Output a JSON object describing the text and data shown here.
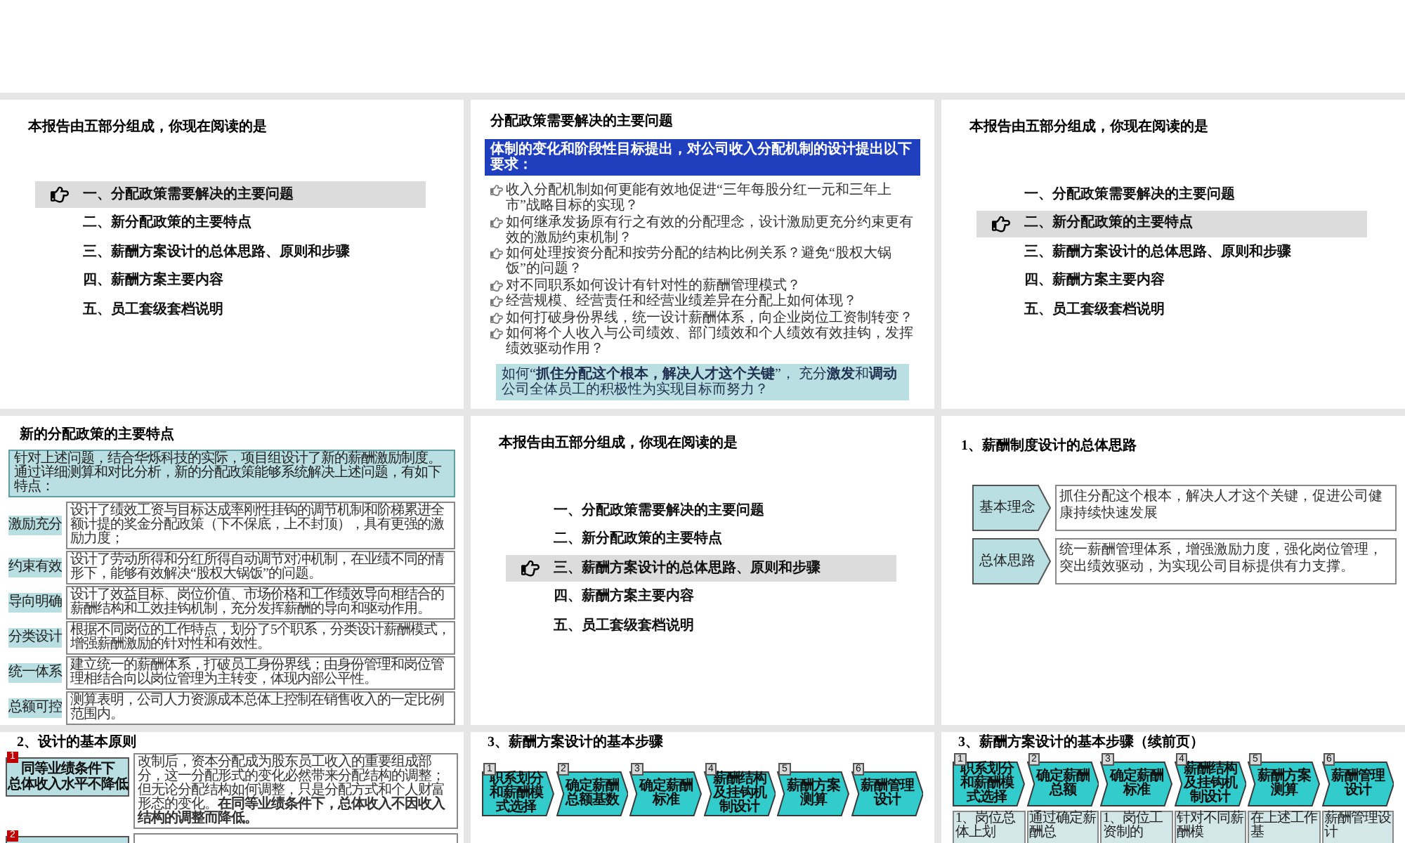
{
  "slides": [
    {
      "kind": "agenda",
      "title": "本报告由五部分组成，你现在阅读的是",
      "items": [
        {
          "label": "一、分配政策需要解决的主要问题",
          "selected": true
        },
        {
          "label": "二、新分配政策的主要特点",
          "selected": false
        },
        {
          "label": "三、薪酬方案设计的总体思路、原则和步骤",
          "selected": false
        },
        {
          "label": "四、薪酬方案主要内容",
          "selected": false
        },
        {
          "label": "五、员工套级套档说明",
          "selected": false
        }
      ]
    },
    {
      "kind": "problems",
      "title": "分配政策需要解决的主要问题",
      "banner": "体制的变化和阶段性目标提出，对公司收入分配机制的设计提出以下要求：",
      "bullets": [
        "收入分配机制如何更能有效地促进“三年每股分红一元和三年上市”战略目标的实现？",
        "如何继承发扬原有行之有效的分配理念，设计激励更充分约束更有效的激励约束机制？",
        "如何处理按资分配和按劳分配的结构比例关系？避免“股权大锅饭”的问题？",
        "对不同职系如何设计有针对性的薪酬管理模式？",
        "经营规模、经营责任和经营业绩差异在分配上如何体现？",
        "如何打破身份界线，统一设计薪酬体系，向企业岗位工资制转变？",
        "如何将个人收入与公司绩效、部门绩效和个人绩效有效挂钩，发挥绩效驱动作用？"
      ],
      "conclusion": "如何“**抓住分配这个根本，解决人才这个关键**”， 充分**激发**和**调动**公司全体员工的积极性为实现目标而努力？"
    },
    {
      "kind": "agenda",
      "title": "本报告由五部分组成，你现在阅读的是",
      "items": [
        {
          "label": "一、分配政策需要解决的主要问题",
          "selected": false
        },
        {
          "label": "二、新分配政策的主要特点",
          "selected": true
        },
        {
          "label": "三、薪酬方案设计的总体思路、原则和步骤",
          "selected": false
        },
        {
          "label": "四、薪酬方案主要内容",
          "selected": false
        },
        {
          "label": "五、员工套级套档说明",
          "selected": false
        }
      ]
    },
    {
      "kind": "features",
      "title": "新的分配政策的主要特点",
      "intro": "针对上述问题，结合华烁科技的实际，项目组设计了新的薪酬激励制度。通过详细测算和对比分析，新的分配政策能够系统解决上述问题，有如下特点：",
      "rows": [
        {
          "label": "激励充分",
          "text": "设计了绩效工资与目标达成率刚性挂钩的调节机制和阶梯累进全额计提的奖金分配政策（下不保底，上不封顶），具有更强的激励力度；"
        },
        {
          "label": "约束有效",
          "text": "设计了劳动所得和分红所得自动调节对冲机制，在业绩不同的情形下，能够有效解决“股权大锅饭”的问题。"
        },
        {
          "label": "导向明确",
          "text": "设计了效益目标、岗位价值、市场价格和工作绩效导向相结合的薪酬结构和工效挂钩机制，充分发挥薪酬的导向和驱动作用。"
        },
        {
          "label": "分类设计",
          "text": "根据不同岗位的工作特点，划分了5个职系，分类设计薪酬模式，增强薪酬激励的针对性和有效性。"
        },
        {
          "label": "统一体系",
          "text": "建立统一的薪酬体系，打破员工身份界线；由身份管理和岗位管理相结合向以岗位管理为主转变，体现内部公平性。"
        },
        {
          "label": "总额可控",
          "text": "测算表明，公司人力资源成本总体上控制在销售收入的一定比例范围内。"
        }
      ]
    },
    {
      "kind": "agenda",
      "title": "本报告由五部分组成，你现在阅读的是",
      "items": [
        {
          "label": "一、分配政策需要解决的主要问题",
          "selected": false
        },
        {
          "label": "二、新分配政策的主要特点",
          "selected": false
        },
        {
          "label": "三、薪酬方案设计的总体思路、原则和步骤",
          "selected": true
        },
        {
          "label": "四、薪酬方案主要内容",
          "selected": false
        },
        {
          "label": "五、员工套级套档说明",
          "selected": false
        }
      ]
    },
    {
      "kind": "concepts",
      "title": "1、薪酬制度设计的总体思路",
      "rows": [
        {
          "label": "基本理念",
          "text": "抓住分配这个根本，解决人才这个关键，促进公司健康持续快速发展"
        },
        {
          "label": "总体思路",
          "text": "统一薪酬管理体系，增强激励力度，强化岗位管理，突出绩效驱动，为实现公司目标提供有力支撑。"
        }
      ]
    },
    {
      "kind": "principles",
      "title": "2、设计的基本原则",
      "principles": [
        {
          "number": "1",
          "label_lines": [
            "同等业绩条件下",
            "总体收入水平不降低"
          ],
          "text": "改制后，资本分配成为股东员工收入的重要组成部分，这一分配形式的变化必然带来分配结构的调整；但无论分配结构如何调整，只是分配方式和个人财富形态的变化。**在同等业绩条件下，总体收入不因收入结构的调整而降低。**"
        },
        {
          "number": "2"
        }
      ]
    },
    {
      "kind": "steps",
      "title": "3、薪酬方案设计的基本步骤",
      "steps": [
        {
          "number": "1",
          "label": "职系划分和薪酬模式选择"
        },
        {
          "number": "2",
          "label": "确定薪酬总额基数"
        },
        {
          "number": "3",
          "label": "确定薪酬标准"
        },
        {
          "number": "4",
          "label": "薪酬结构及挂钩机制设计"
        },
        {
          "number": "5",
          "label": "薪酬方案测算"
        },
        {
          "number": "6",
          "label": "薪酬管理设计"
        }
      ]
    },
    {
      "kind": "steps",
      "title": "3、薪酬方案设计的基本步骤（续前页）",
      "steps": [
        {
          "number": "1",
          "label": "职系划分和薪酬模式选择"
        },
        {
          "number": "2",
          "label": "确定薪酬总额"
        },
        {
          "number": "3",
          "label": "确定薪酬标准"
        },
        {
          "number": "4",
          "label": "薪酬结构及挂钩机制设计"
        },
        {
          "number": "5",
          "label": "薪酬方案测算"
        },
        {
          "number": "6",
          "label": "薪酬管理设计"
        }
      ],
      "details": [
        "1、岗位总体上划",
        "通过确定薪酬总",
        "1、岗位工资制的",
        "针对不同薪酬模",
        "在上述工作基",
        "薪酬管理设计"
      ]
    }
  ]
}
